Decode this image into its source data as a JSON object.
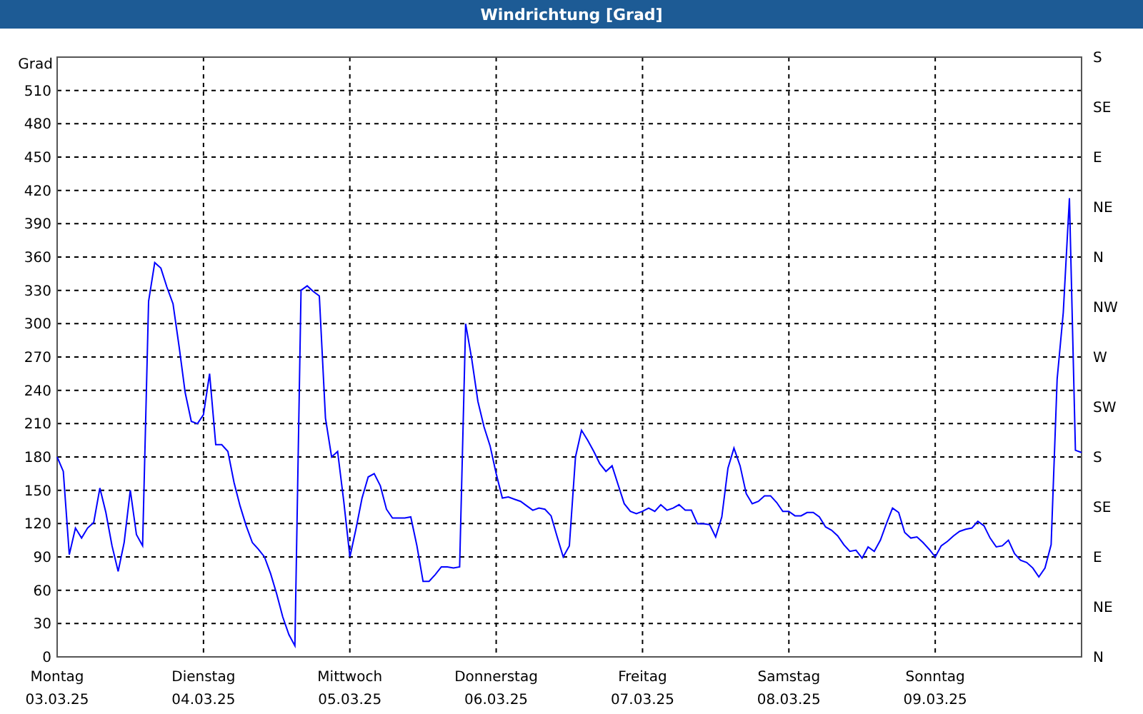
{
  "window": {
    "title": "Windrichtung [Grad]"
  },
  "chart": {
    "chart_data": {
      "type": "line",
      "grid": true,
      "ylabel": "Grad",
      "ylim": [
        0,
        540
      ],
      "yticks": [
        0,
        30,
        60,
        90,
        120,
        150,
        180,
        210,
        240,
        270,
        300,
        330,
        360,
        390,
        420,
        450,
        480,
        510
      ],
      "categories": [
        "03.03.25",
        null,
        null,
        null,
        null,
        null,
        null,
        null,
        null,
        null,
        null,
        null,
        null,
        null,
        null,
        null,
        null,
        null,
        null,
        null,
        null,
        null,
        null,
        null,
        "04.03.25",
        null,
        null,
        null,
        null,
        null,
        null,
        null,
        null,
        null,
        null,
        null,
        null,
        null,
        null,
        null,
        null,
        null,
        null,
        null,
        null,
        null,
        null,
        null,
        "05.03.25",
        null,
        null,
        null,
        null,
        null,
        null,
        null,
        null,
        null,
        null,
        null,
        null,
        null,
        null,
        null,
        null,
        null,
        null,
        null,
        null,
        null,
        null,
        null,
        "06.03.25",
        null,
        null,
        null,
        null,
        null,
        null,
        null,
        null,
        null,
        null,
        null,
        null,
        null,
        null,
        null,
        null,
        null,
        null,
        null,
        null,
        null,
        null,
        null,
        "07.03.25",
        null,
        null,
        null,
        null,
        null,
        null,
        null,
        null,
        null,
        null,
        null,
        null,
        null,
        null,
        null,
        null,
        null,
        null,
        null,
        null,
        null,
        null,
        null,
        "08.03.25",
        null,
        null,
        null,
        null,
        null,
        null,
        null,
        null,
        null,
        null,
        null,
        null,
        null,
        null,
        null,
        null,
        null,
        null,
        null,
        null,
        null,
        null,
        null,
        "09.03.25",
        null,
        null,
        null,
        null,
        null,
        null,
        null,
        null,
        null,
        null,
        null,
        null,
        null,
        null,
        null,
        null,
        null,
        null,
        null,
        null,
        null,
        null,
        null,
        null
      ],
      "series": [
        {
          "color": "#0000ff",
          "values": [
            180,
            167,
            92,
            116,
            107,
            116,
            121,
            152,
            130,
            100,
            77,
            103,
            150,
            110,
            100,
            320,
            355,
            350,
            333,
            318,
            279,
            238,
            212,
            210,
            218,
            255,
            191,
            191,
            185,
            157,
            136,
            118,
            103,
            97,
            90,
            75,
            57,
            36,
            20,
            10,
            330,
            334,
            329,
            325,
            215,
            180,
            185,
            140,
            90,
            115,
            143,
            162,
            165,
            154,
            133,
            125,
            125,
            125,
            126,
            100,
            68,
            68,
            74,
            81,
            81,
            80,
            81,
            300,
            268,
            230,
            207,
            190,
            165,
            143,
            144,
            142,
            140,
            136,
            132,
            134,
            133,
            127,
            108,
            90,
            100,
            180,
            204,
            195,
            185,
            174,
            167,
            172,
            155,
            138,
            131,
            129,
            131,
            134,
            131,
            137,
            132,
            134,
            137,
            132,
            132,
            120,
            120,
            119,
            108,
            126,
            170,
            188,
            172,
            147,
            138,
            140,
            145,
            145,
            139,
            131,
            131,
            127,
            127,
            130,
            130,
            126,
            117,
            114,
            109,
            101,
            95,
            96,
            89,
            99,
            95,
            105,
            120,
            134,
            130,
            112,
            107,
            108,
            103,
            97,
            90,
            100,
            104,
            109,
            113,
            115,
            116,
            122,
            118,
            107,
            99,
            100,
            105,
            93,
            87,
            85,
            80,
            72,
            80,
            101,
            250,
            310,
            413,
            186,
            184
          ]
        }
      ]
    },
    "right_axis_labels": [
      "S",
      "SE",
      "E",
      "NE",
      "N",
      "NW",
      "W",
      "SW",
      "S",
      "SE",
      "E",
      "NE",
      "N"
    ],
    "x_weekdays": [
      "Montag",
      "Dienstag",
      "Mittwoch",
      "Donnerstag",
      "Freitag",
      "Samstag",
      "Sonntag"
    ]
  }
}
